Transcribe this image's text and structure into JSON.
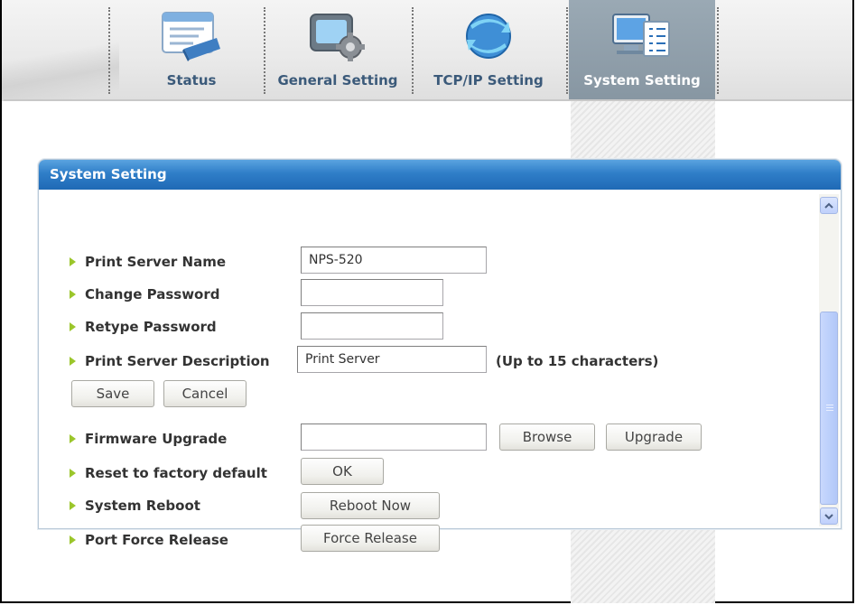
{
  "nav": {
    "tabs": [
      {
        "label": "Status",
        "icon": "status-icon"
      },
      {
        "label": "General Setting",
        "icon": "general-setting-icon"
      },
      {
        "label": "TCP/IP Setting",
        "icon": "tcpip-icon"
      },
      {
        "label": "System Setting",
        "icon": "system-setting-icon",
        "active": true
      }
    ]
  },
  "panel": {
    "title": "System Setting",
    "fields": {
      "server_name": {
        "label": "Print Server Name",
        "value": "NPS-520"
      },
      "change_password": {
        "label": "Change Password",
        "value": ""
      },
      "retype_password": {
        "label": "Retype Password",
        "value": ""
      },
      "description": {
        "label": "Print Server Description",
        "value": "Print Server",
        "note": "(Up to 15 characters)"
      }
    },
    "buttons": {
      "save": "Save",
      "cancel": "Cancel",
      "browse": "Browse",
      "upgrade": "Upgrade",
      "ok": "OK",
      "reboot_now": "Reboot Now",
      "force_release": "Force Release"
    },
    "actions": {
      "firmware_upgrade": "Firmware Upgrade",
      "reset_factory": "Reset to factory default",
      "system_reboot": "System Reboot",
      "port_force_release": "Port Force Release"
    }
  },
  "colors": {
    "header_blue": "#2f7ec8",
    "arrow_green": "#9bc62b",
    "active_tab": "#8f9ea9",
    "scrollbar_blue": "#bcd0fb"
  }
}
